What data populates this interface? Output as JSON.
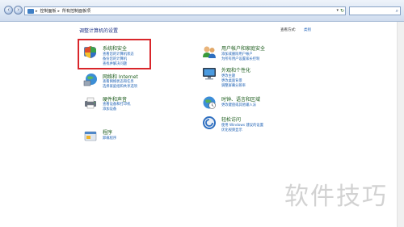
{
  "address": {
    "crumb1": "控制面板",
    "crumb2": "所有控制面板项"
  },
  "heading": "调整计算机的设置",
  "view_by": {
    "label": "查看方式:",
    "value": "类别"
  },
  "categories": {
    "system": {
      "title": "系统和安全",
      "links": [
        "查看您的计算机状态",
        "备份您的计算机",
        "查找并解决问题"
      ]
    },
    "network": {
      "title": "网络和 Internet",
      "links": [
        "查看网络状态和任务",
        "选择家庭组和共享选项"
      ]
    },
    "hardware": {
      "title": "硬件和声音",
      "links": [
        "查看设备和打印机",
        "添加设备"
      ]
    },
    "programs": {
      "title": "程序",
      "links": [
        "卸载程序"
      ]
    },
    "users": {
      "title": "用户帐户和家庭安全",
      "links": [
        "添加或删除用户帐户",
        "为所有用户设置家长控制"
      ]
    },
    "appearance": {
      "title": "外观和个性化",
      "links": [
        "更改主题",
        "更改桌面背景",
        "调整屏幕分辨率"
      ]
    },
    "clock": {
      "title": "时钟、语言和区域",
      "links": [
        "更改键盘或其他输入法"
      ]
    },
    "access": {
      "title": "轻松访问",
      "links": [
        "使用 Windows 建议的设置",
        "优化视频显示"
      ]
    }
  },
  "watermark": "软件技巧"
}
